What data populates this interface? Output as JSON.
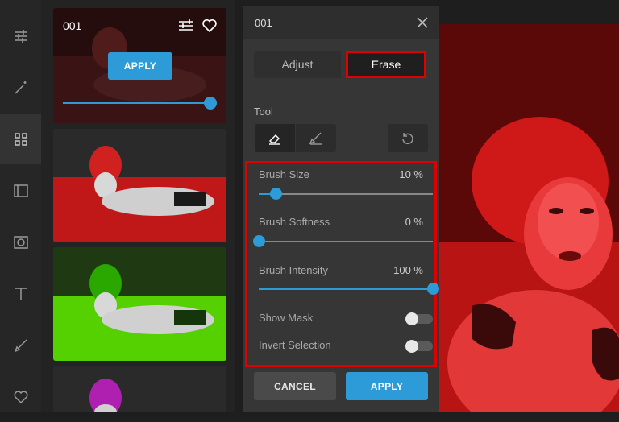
{
  "rail": {
    "icons": [
      "sliders-icon",
      "magic-wand-icon",
      "grid-icon",
      "film-icon",
      "vignette-icon",
      "text-icon",
      "brush-icon",
      "heart-icon"
    ]
  },
  "thumbnails": {
    "first": {
      "number": "001",
      "apply_label": "APPLY",
      "intensity": 1.0
    }
  },
  "panel": {
    "title": "001",
    "tabs": {
      "adjust": "Adjust",
      "erase": "Erase"
    },
    "tool_label": "Tool",
    "sliders": [
      {
        "label": "Brush Size",
        "value": "10 %",
        "fraction": 0.1
      },
      {
        "label": "Brush Softness",
        "value": "0 %",
        "fraction": 0.0
      },
      {
        "label": "Brush Intensity",
        "value": "100 %",
        "fraction": 1.0
      }
    ],
    "toggles": [
      {
        "label": "Show Mask",
        "on": false
      },
      {
        "label": "Invert Selection",
        "on": false
      }
    ],
    "cancel_label": "CANCEL",
    "apply_label": "APPLY"
  },
  "colors": {
    "accent": "#2d9bd8",
    "highlight": "#e00000"
  }
}
